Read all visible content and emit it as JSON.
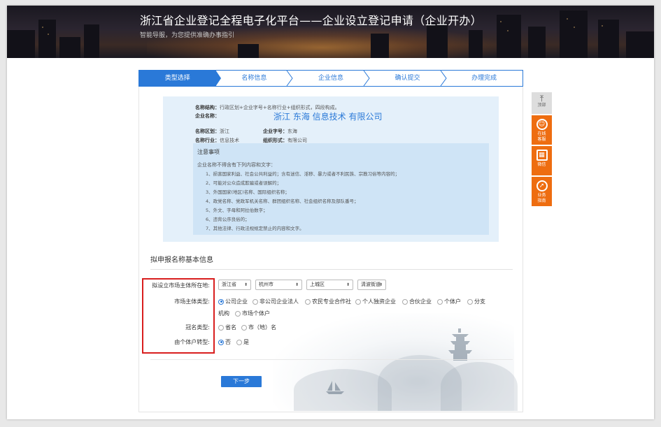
{
  "banner": {
    "title": "浙江省企业登记全程电子化平台——企业设立登记申请（企业开办）",
    "subtitle": "智能导服，为您提供准确办事指引"
  },
  "steps": [
    {
      "label": "类型选择",
      "active": true
    },
    {
      "label": "名称信息",
      "active": false
    },
    {
      "label": "企业信息",
      "active": false
    },
    {
      "label": "确认提交",
      "active": false
    },
    {
      "label": "办理完成",
      "active": false
    }
  ],
  "name_info": {
    "structure_label": "名称结构：",
    "structure_value": "行政区划+企业字号+名称行业+组织形式，四段构成。",
    "company_label": "企业名称：",
    "company_name": "浙江 东海 信息技术 有限公司",
    "region_label": "名称区划：",
    "region_value": "浙江",
    "brand_label": "企业字号：",
    "brand_value": "东海",
    "industry_label": "名称行业：",
    "industry_value": "信息技术",
    "org_label": "组织形式：",
    "org_value": "有限公司"
  },
  "notice": {
    "title": "注意事项",
    "intro": "企业名称不得含有下列内容和文字：",
    "items": [
      "1、损害国家利益、社会公共利益的；含有迷信、淫秽、暴力或者不利民族、宗教习俗等内容的；",
      "2、可能对公众造成欺骗或者误解的；",
      "3、外国国家(地区)名称、国际组织名称；",
      "4、政党名称、党政军机关名称、群团组织名称、社会组织名称及部队番号；",
      "5、外文、字母和阿拉伯数字；",
      "6、违背公序良俗的；",
      "7、其他法律、行政法规规定禁止的内容和文字。"
    ]
  },
  "form": {
    "section_title": "拟申报名称基本信息",
    "location_label": "拟设立市场主体所在地:",
    "province": "浙江省",
    "city": "杭州市",
    "district": "上城区",
    "street": "清波街道",
    "entity_type_label": "市场主体类型:",
    "entity_types": [
      "公司企业",
      "非公司企业法人",
      "农民专业合作社",
      "个人独资企业",
      "合伙企业",
      "个体户",
      "分支",
      "市场个体户"
    ],
    "entity_types_wrap": "机构",
    "crown_label": "冠名类型:",
    "crown_types": [
      "省名",
      "市（地）名"
    ],
    "convert_label": "由个体户转型:",
    "convert_options": [
      "否",
      "是"
    ],
    "next_button": "下一步"
  },
  "side_tools": {
    "top": "顶部",
    "service": "在线客服",
    "wechat": "微信",
    "guide": "业务指南"
  },
  "colors": {
    "primary": "#2a79d8",
    "accent_orange": "#ee6d10",
    "highlight_red": "#d81e1e"
  }
}
